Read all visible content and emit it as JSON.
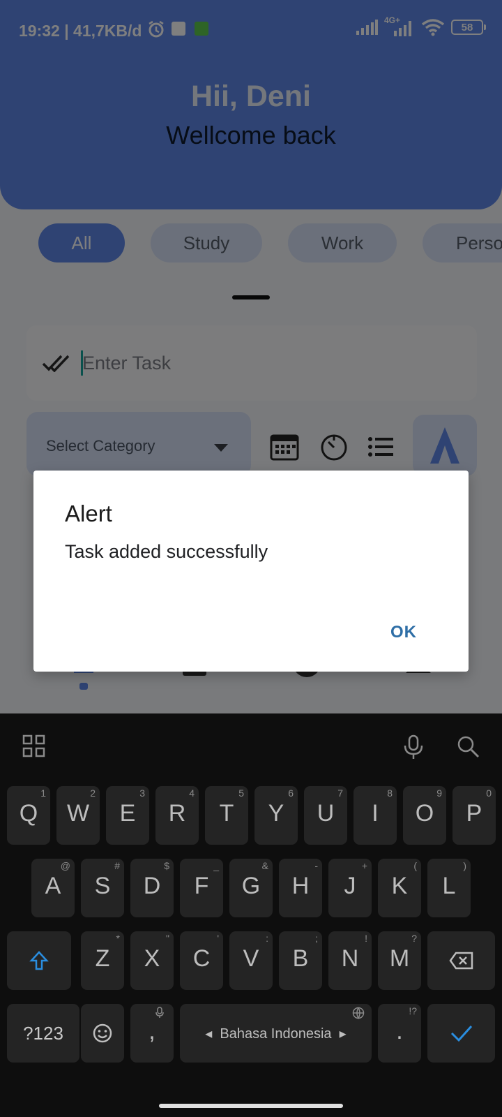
{
  "status_bar": {
    "time_speed": "19:32 | 41,7KB/d",
    "network": "4G+",
    "battery": "58"
  },
  "header": {
    "title": "Hii, Deni",
    "subtitle": "Wellcome back"
  },
  "categories": [
    "All",
    "Study",
    "Work",
    "Perso"
  ],
  "task_input": {
    "placeholder": "Enter Task"
  },
  "category_select": {
    "label": "Select Category"
  },
  "dialog": {
    "title": "Alert",
    "message": "Task added successfully",
    "ok_label": "OK"
  },
  "keyboard": {
    "row1": [
      "Q",
      "W",
      "E",
      "R",
      "T",
      "Y",
      "U",
      "I",
      "O",
      "P"
    ],
    "row1_hints": [
      "1",
      "2",
      "3",
      "4",
      "5",
      "6",
      "7",
      "8",
      "9",
      "0"
    ],
    "row2": [
      "A",
      "S",
      "D",
      "F",
      "G",
      "H",
      "J",
      "K",
      "L"
    ],
    "row2_hints": [
      "@",
      "#",
      "$",
      "_",
      "&",
      "-",
      "+",
      "(",
      ")"
    ],
    "row3": [
      "Z",
      "X",
      "C",
      "V",
      "B",
      "N",
      "M"
    ],
    "row3_hints": [
      "*",
      "\"",
      "'",
      ":",
      ";",
      "!",
      "?"
    ],
    "symbols_label": "?123",
    "comma_label": ",",
    "period_label": ".",
    "period_hint": "!?",
    "space_label": "Bahasa Indonesia"
  },
  "colors": {
    "accent": "#5f87e6",
    "chip_inactive": "#d7e1f6",
    "ok_button": "#2e6ea6",
    "caret": "#15a39b"
  }
}
